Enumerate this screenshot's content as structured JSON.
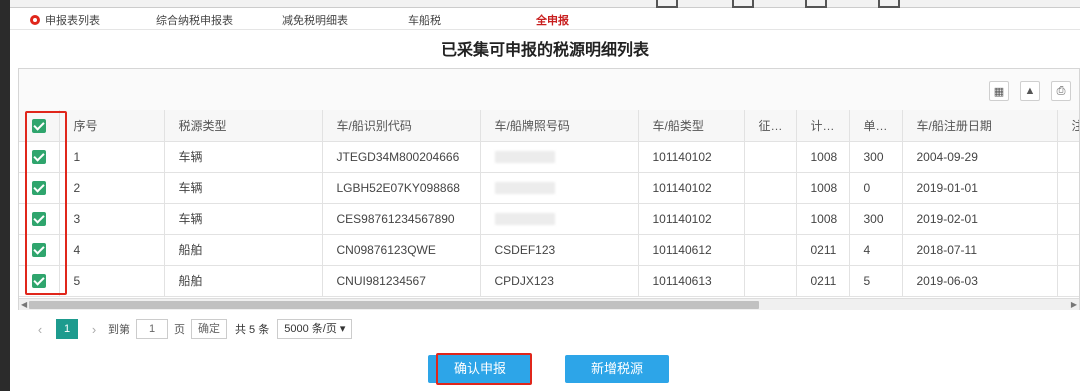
{
  "tabs": [
    {
      "label": "申报表列表",
      "active": false
    },
    {
      "label": "综合纳税申报表",
      "active": false
    },
    {
      "label": "减免税明细表",
      "active": false
    },
    {
      "label": "车船税",
      "active": false
    },
    {
      "label": "全申报",
      "active": true
    }
  ],
  "page_title": "已采集可申报的税源明细列表",
  "toolbar_icons": [
    "columns-icon",
    "export-icon",
    "print-icon"
  ],
  "table": {
    "headers": [
      "序号",
      "税源类型",
      "车/船识别代码",
      "车/船牌照号码",
      "车/船类型",
      "征…",
      "计…",
      "单…",
      "车/船注册日期",
      "注"
    ],
    "rows": [
      {
        "seq": "1",
        "type": "车辆",
        "code": "JTEGD34M800204666",
        "plate": "",
        "kind": "101140102",
        "zheng": "",
        "ji": "1008",
        "dan": "300",
        "date": "2004-09-29",
        "checked": true
      },
      {
        "seq": "2",
        "type": "车辆",
        "code": "LGBH52E07KY098868",
        "plate": "",
        "kind": "101140102",
        "zheng": "",
        "ji": "1008",
        "dan": "0",
        "date": "2019-01-01",
        "checked": true
      },
      {
        "seq": "3",
        "type": "车辆",
        "code": "CES98761234567890",
        "plate": "",
        "kind": "101140102",
        "zheng": "",
        "ji": "1008",
        "dan": "300",
        "date": "2019-02-01",
        "checked": true
      },
      {
        "seq": "4",
        "type": "船舶",
        "code": "CN09876123QWE",
        "plate": "CSDEF123",
        "kind": "101140612",
        "zheng": "",
        "ji": "0211",
        "dan": "4",
        "date": "2018-07-11",
        "checked": true
      },
      {
        "seq": "5",
        "type": "船舶",
        "code": "CNUI981234567",
        "plate": "CPDJX123",
        "kind": "101140613",
        "zheng": "",
        "ji": "0211",
        "dan": "5",
        "date": "2019-06-03",
        "checked": true
      }
    ]
  },
  "pager": {
    "current_page": "1",
    "goto_label": "到第",
    "goto_value": "1",
    "page_unit": "页",
    "confirm_label": "确定",
    "total": "共 5 条",
    "page_size": "5000 条/页"
  },
  "buttons": {
    "confirm_declare": "确认申报",
    "add_source": "新增税源"
  },
  "colors": {
    "accent": "#2da5e8",
    "check": "#2fa56d",
    "highlight": "#e0261b",
    "active_tab": "#c81e1e",
    "page_active": "#1d9b8e"
  }
}
